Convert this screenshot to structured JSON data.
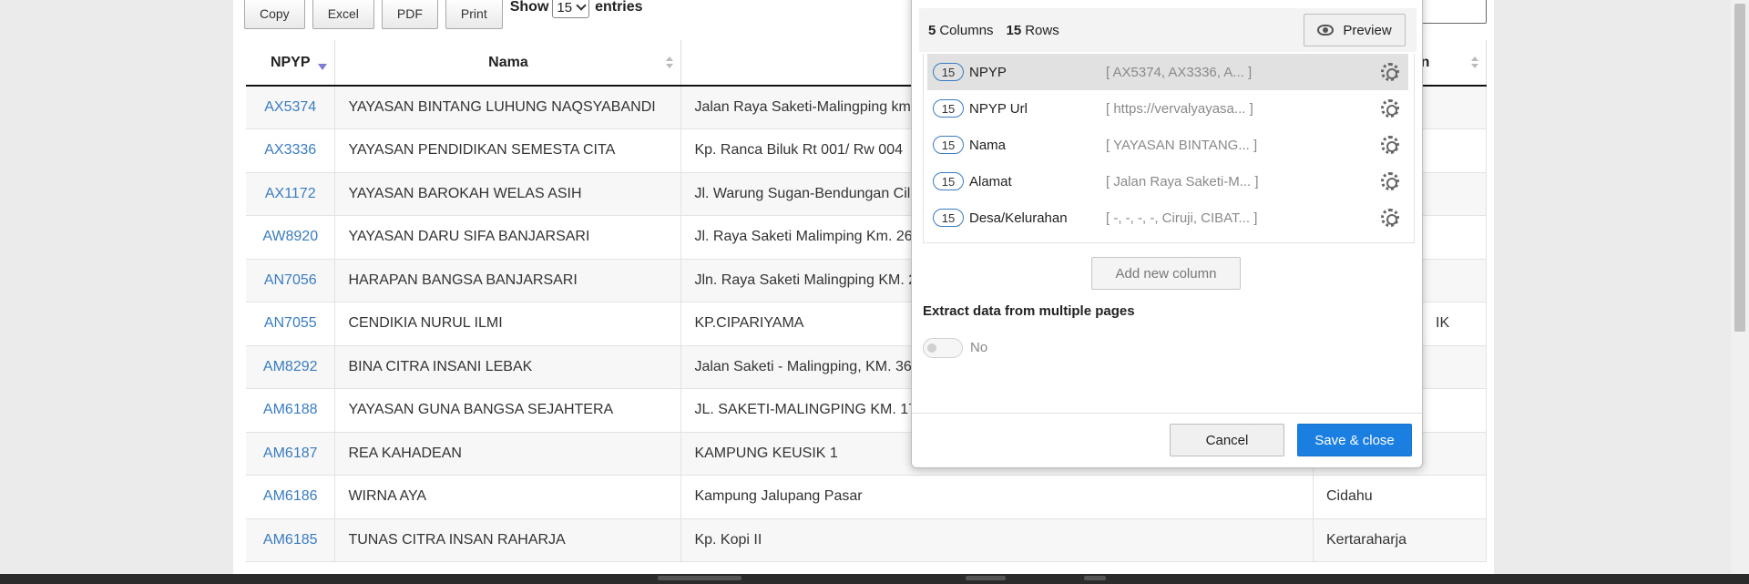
{
  "toolbar": {
    "buttons": [
      "Copy",
      "Excel",
      "PDF",
      "Print"
    ],
    "show_label": "Show",
    "entries_value": "15",
    "entries_label": "entries"
  },
  "table": {
    "columns": [
      "NPYP",
      "Nama",
      "",
      "ahan"
    ],
    "rows": [
      {
        "npyp": "AX5374",
        "nama": "YAYASAN BINTANG LUHUNG NAQSYABANDI",
        "alamat": "Jalan Raya Saketi-Malingping km",
        "desa": ""
      },
      {
        "npyp": "AX3336",
        "nama": "YAYASAN PENDIDIKAN SEMESTA CITA",
        "alamat": "Kp. Ranca Biluk Rt 001/ Rw 004",
        "desa": ""
      },
      {
        "npyp": "AX1172",
        "nama": "YAYASAN BAROKAH WELAS ASIH",
        "alamat": "Jl. Warung Sugan-Bendungan Cil",
        "desa": ""
      },
      {
        "npyp": "AW8920",
        "nama": "YAYASAN DARU SIFA BANJARSARI",
        "alamat": "Jl. Raya Saketi Malimping Km. 26",
        "desa": ""
      },
      {
        "npyp": "AN7056",
        "nama": "HARAPAN BANGSA BANJARSARI",
        "alamat": "Jln. Raya Saketi Malingping KM. 2",
        "desa": ""
      },
      {
        "npyp": "AN7055",
        "nama": "CENDIKIA NURUL ILMI",
        "alamat": "KP.CIPARIYAMA",
        "desa": "IK"
      },
      {
        "npyp": "AM8292",
        "nama": "BINA CITRA INSANI LEBAK",
        "alamat": "Jalan Saketi - Malingping, KM. 36",
        "desa": ""
      },
      {
        "npyp": "AM6188",
        "nama": "YAYASAN GUNA BANGSA SEJAHTERA",
        "alamat": "JL. SAKETI-MALINGPING KM. 17",
        "desa": ""
      },
      {
        "npyp": "AM6187",
        "nama": "REA KAHADEAN",
        "alamat": "KAMPUNG KEUSIK 1",
        "desa": ""
      },
      {
        "npyp": "AM6186",
        "nama": "WIRNA AYA",
        "alamat": "Kampung Jalupang Pasar",
        "desa": "Cidahu"
      },
      {
        "npyp": "AM6185",
        "nama": "TUNAS CITRA INSAN RAHARJA",
        "alamat": "Kp. Kopi II",
        "desa": "Kertaraharja"
      }
    ]
  },
  "dialog": {
    "columns_count": "5",
    "columns_label": "Columns",
    "rows_count": "15",
    "rows_label": "Rows",
    "preview_label": "Preview",
    "columns": [
      {
        "count": "15",
        "name": "NPYP",
        "sample": "[ AX5374, AX3336, A... ]"
      },
      {
        "count": "15",
        "name": "NPYP Url",
        "sample": "[ https://vervalyayasa... ]"
      },
      {
        "count": "15",
        "name": "Nama",
        "sample": "[ YAYASAN BINTANG... ]"
      },
      {
        "count": "15",
        "name": "Alamat",
        "sample": "[ Jalan Raya Saketi-M... ]"
      },
      {
        "count": "15",
        "name": "Desa/Kelurahan",
        "sample": "[ -, -, -, -, Ciruji, CIBAT... ]"
      }
    ],
    "add_column_label": "Add new column",
    "extract_label": "Extract data from multiple pages",
    "toggle_label": "No",
    "cancel_label": "Cancel",
    "save_label": "Save & close"
  }
}
